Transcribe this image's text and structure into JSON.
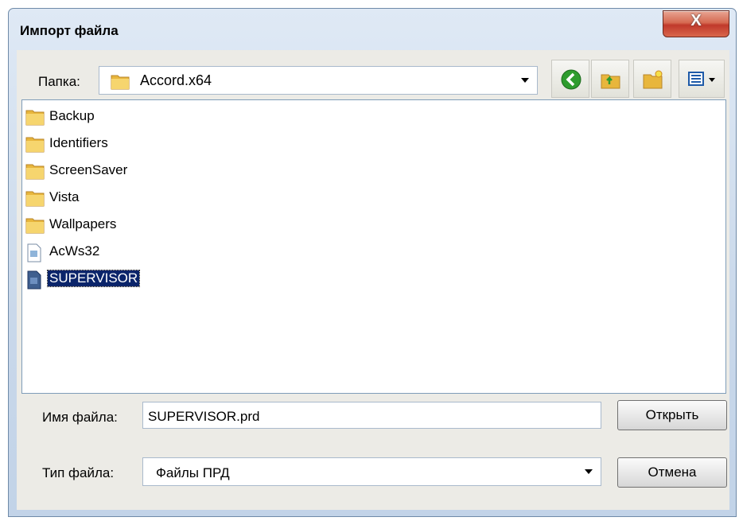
{
  "window": {
    "title": "Импорт файла",
    "close_label": "X"
  },
  "folder": {
    "label": "Папка:",
    "current": "Accord.x64"
  },
  "toolbar": {
    "back_icon": "back-icon",
    "up_icon": "folder-up-icon",
    "new_folder_icon": "new-folder-icon",
    "view_icon": "view-menu-icon"
  },
  "files": [
    {
      "name": "Backup",
      "type": "folder"
    },
    {
      "name": "Identifiers",
      "type": "folder"
    },
    {
      "name": "ScreenSaver",
      "type": "folder"
    },
    {
      "name": "Vista",
      "type": "folder"
    },
    {
      "name": "Wallpapers",
      "type": "folder"
    },
    {
      "name": "AcWs32",
      "type": "file"
    },
    {
      "name": "SUPERVISOR",
      "type": "file",
      "selected": true
    }
  ],
  "filename": {
    "label": "Имя файла:",
    "value": "SUPERVISOR.prd"
  },
  "filetype": {
    "label": "Тип файла:",
    "value": "Файлы ПРД"
  },
  "buttons": {
    "open": "Открыть",
    "cancel": "Отмена"
  },
  "colors": {
    "selection": "#0a246a",
    "close": "#c0392b"
  }
}
